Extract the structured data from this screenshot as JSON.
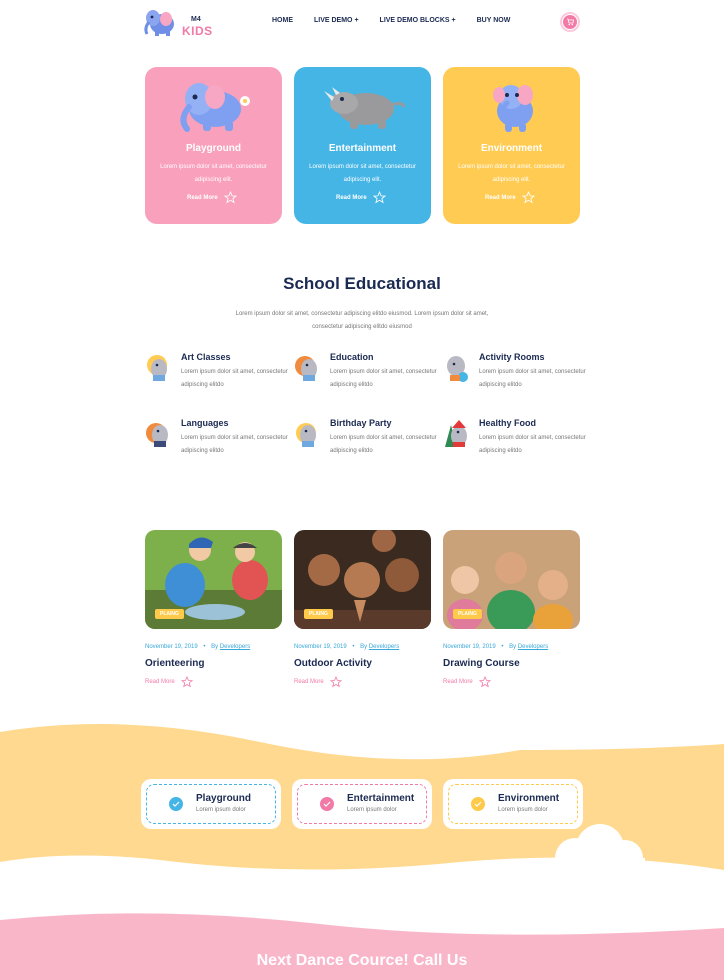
{
  "brand": {
    "line1": "M4",
    "line2": "KIDS"
  },
  "nav": {
    "items": [
      "HOME",
      "LIVE DEMO +",
      "LIVE DEMO BLOCKS +",
      "BUY NOW"
    ],
    "cart_icon": "cart-icon"
  },
  "top_cards": [
    {
      "title": "Playground",
      "text": "Lorem ipsum dolor sit amet, consectetur adipiscing elit.",
      "more": "Read More",
      "color": "#f9a0bd"
    },
    {
      "title": "Entertainment",
      "text": "Lorem ipsum dolor sit amet, consectetur adipiscing elit.",
      "more": "Read More",
      "color": "#45b5e5"
    },
    {
      "title": "Environment",
      "text": "Lorem ipsum dolor sit amet, consectetur adipiscing elit.",
      "more": "Read More",
      "color": "#ffcb52"
    }
  ],
  "section": {
    "title": "School Educational",
    "desc": "Lorem ipsum dolor sit amet, consectetur adipiscing elitdo eiusmod. Lorem ipsum dolor sit amet, consectetur adipiscing elitdo eiusmod"
  },
  "features": [
    {
      "title": "Art Classes",
      "text": "Lorem ipsum dolor sit amet, consectetur adipiscing elitdo"
    },
    {
      "title": "Education",
      "text": "Lorem ipsum dolor sit amet, consectetur adipiscing elitdo"
    },
    {
      "title": "Activity Rooms",
      "text": "Lorem ipsum dolor sit amet, consectetur adipiscing elitdo"
    },
    {
      "title": "Languages",
      "text": "Lorem ipsum dolor sit amet, consectetur adipiscing elitdo"
    },
    {
      "title": "Birthday Party",
      "text": "Lorem ipsum dolor sit amet, consectetur adipiscing elitdo"
    },
    {
      "title": "Healthy Food",
      "text": "Lorem ipsum dolor sit amet, consectetur adipiscing elitdo"
    }
  ],
  "posts": [
    {
      "badge": "PLAING",
      "date": "November 19, 2019",
      "by": "By",
      "author": "Developers",
      "title": "Orienteering",
      "more": "Read More"
    },
    {
      "badge": "PLAING",
      "date": "November 19, 2019",
      "by": "By",
      "author": "Developers",
      "title": "Outdoor Activity",
      "more": "Read More"
    },
    {
      "badge": "PLAING",
      "date": "November 19, 2019",
      "by": "By",
      "author": "Developers",
      "title": "Drawing Course",
      "more": "Read More"
    }
  ],
  "bottom_cards": [
    {
      "title": "Playground",
      "sub": "Lorem ipsum dolor",
      "color": "#45b5e5"
    },
    {
      "title": "Entertainment",
      "sub": "Lorem ipsum dolor",
      "color": "#f27aa7"
    },
    {
      "title": "Environment",
      "sub": "Lorem ipsum dolor",
      "color": "#ffc94a"
    }
  ],
  "cta": {
    "text": "Next Dance Cource! Call Us"
  }
}
